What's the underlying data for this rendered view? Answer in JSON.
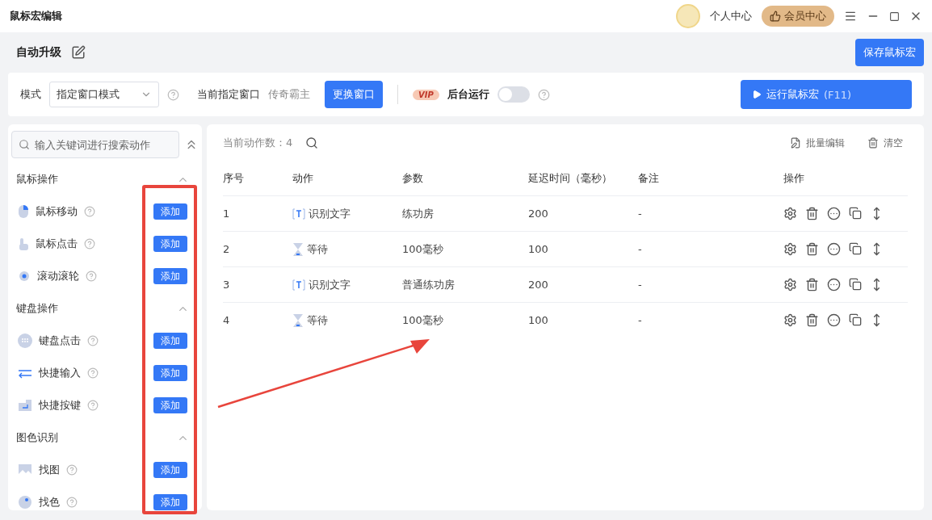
{
  "window": {
    "title": "鼠标宏编辑",
    "user_link": "个人中心",
    "member_button": "会员中心"
  },
  "header": {
    "name": "自动升级",
    "save_button": "保存鼠标宏"
  },
  "toolbar": {
    "mode_label": "模式",
    "mode_value": "指定窗口模式",
    "window_label": "当前指定窗口",
    "window_value": "传奇霸主",
    "change_button": "更换窗口",
    "vip_badge": "VIP",
    "background_label": "后台运行",
    "background_on": false,
    "run_button": "运行鼠标宏",
    "run_shortcut": "(F11)"
  },
  "sidebar": {
    "search_placeholder": "输入关键词进行搜索动作",
    "groups": [
      {
        "title": "鼠标操作",
        "expanded": true,
        "items": [
          {
            "label": "鼠标移动",
            "kind": "mouse",
            "button": "添加"
          },
          {
            "label": "鼠标点击",
            "kind": "click",
            "button": "添加"
          },
          {
            "label": "滚动滚轮",
            "kind": "wheel",
            "button": "添加"
          }
        ]
      },
      {
        "title": "键盘操作",
        "expanded": true,
        "items": [
          {
            "label": "键盘点击",
            "kind": "keyboard",
            "button": "添加"
          },
          {
            "label": "快捷输入",
            "kind": "input",
            "button": "添加"
          },
          {
            "label": "快捷按键",
            "kind": "enter",
            "button": "添加"
          }
        ]
      },
      {
        "title": "图色识别",
        "expanded": true,
        "items": [
          {
            "label": "找图",
            "kind": "image",
            "button": "添加"
          },
          {
            "label": "找色",
            "kind": "palette",
            "button": "添加"
          }
        ]
      }
    ]
  },
  "actions": {
    "count_label": "当前动作数：4",
    "batch_edit": "批量编辑",
    "clear": "清空",
    "columns": [
      "序号",
      "动作",
      "参数",
      "延迟时间（毫秒）",
      "备注",
      "操作"
    ],
    "rows": [
      {
        "index": "1",
        "kind": "text",
        "action": "识别文字",
        "param": "练功房",
        "delay": "200",
        "note": "-"
      },
      {
        "index": "2",
        "kind": "wait",
        "action": "等待",
        "param": "100毫秒",
        "delay": "100",
        "note": "-"
      },
      {
        "index": "3",
        "kind": "text",
        "action": "识别文字",
        "param": "普通练功房",
        "delay": "200",
        "note": "-"
      },
      {
        "index": "4",
        "kind": "wait",
        "action": "等待",
        "param": "100毫秒",
        "delay": "100",
        "note": "-"
      }
    ]
  }
}
